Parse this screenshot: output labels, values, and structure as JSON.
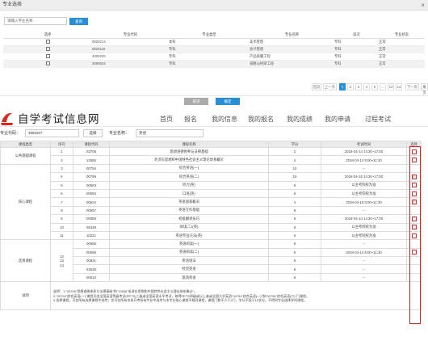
{
  "dialog": {
    "title": "专业选择",
    "close_icon": "close-icon",
    "search_placeholder": "请输入专业名称",
    "search_button": "查询",
    "cancel": "取消",
    "confirm": "确定"
  },
  "major_table": {
    "headers": [
      "选择",
      "专业代码",
      "专业类型",
      "专业名称",
      "层次",
      "专业状态"
    ],
    "rows": [
      {
        "code": "0020214",
        "type": "本科",
        "name": "美术管理",
        "level": "专科",
        "status": "正常"
      },
      {
        "code": "0020116",
        "type": "专科",
        "name": "会计管理",
        "level": "专科",
        "status": "正常"
      },
      {
        "code": "4302220",
        "type": "专科",
        "name": "产品质量工程",
        "level": "专科",
        "status": "正常"
      },
      {
        "code": "3090602",
        "type": "专科",
        "name": "道路与桥梁工程",
        "level": "专科",
        "status": "正常"
      }
    ]
  },
  "pager": {
    "first": "首页",
    "prev": "上一页",
    "pages": [
      "1",
      "2",
      "3",
      "4",
      "5",
      "...",
      "13",
      "14"
    ],
    "next": "下一页",
    "last": "尾页"
  },
  "site": {
    "logo_text": "自学考试信息网",
    "nav": [
      "首页",
      "报名",
      "我的信息",
      "我的报名",
      "我的成绩",
      "我的申请",
      "过程考试"
    ]
  },
  "filter": {
    "code_label": "专业代码：",
    "code_value": "3050207",
    "select_button": "选择",
    "name_label": "专业名称：",
    "name_value": "英语"
  },
  "course_table": {
    "headers": [
      "课程类型",
      "序号",
      "课程代码",
      "课程名称",
      "学分",
      "考试时间",
      "选择"
    ],
    "groups": {
      "public": "公共基础课程",
      "core": "核心课程",
      "elective": "选择课程",
      "note": "说明"
    },
    "rows": [
      {
        "no": "1",
        "code": "03706",
        "name": "思想道德修养与法律基础",
        "credit": "2",
        "time": "2018-04-14 14:30~17:00"
      },
      {
        "no": "2",
        "code": "12656",
        "name": "毛泽东思想和中国特色社会主义理论体系概论",
        "credit": "4",
        "time": "2018-04-14 9:00~11:30"
      },
      {
        "no": "3",
        "code": "00794",
        "name": "综合英语(一)",
        "credit": "10",
        "time": "--"
      },
      {
        "no": "4",
        "code": "00795",
        "name": "综合英语(二)",
        "credit": "10",
        "time": "2018-04-15 14:30~17:00"
      },
      {
        "no": "5",
        "code": "00593",
        "name": "听力(英)",
        "credit": "6",
        "time": "以主考院校为准"
      },
      {
        "no": "6",
        "code": "00594",
        "name": "口语(英)",
        "credit": "6",
        "time": "以主考院校为准"
      },
      {
        "no": "7",
        "code": "00522",
        "name": "英语国家概况",
        "credit": "4",
        "time": "2018-04-15 9:00~11:30"
      },
      {
        "no": "8",
        "code": "00597",
        "name": "英语写作基础",
        "credit": "6",
        "time": "--"
      },
      {
        "no": "9",
        "code": "00089",
        "name": "初级翻译技巧",
        "credit": "6",
        "time": "2018-04-14 14:30~17:00"
      },
      {
        "no": "10",
        "code": "05348",
        "name": "阅读(二)(英)",
        "credit": "6",
        "time": "以主考院校为准"
      },
      {
        "no": "11",
        "code": "10221",
        "name": "英语专业方法(英)",
        "credit": "6",
        "time": "以主考院校为准"
      },
      {
        "no": "",
        "code": "00595",
        "name": "英语阅读(一)",
        "credit": "6",
        "time": "--"
      },
      {
        "no": "",
        "code": "00596",
        "name": "英语阅读(二)",
        "credit": "6",
        "time": "2018-04-14 9:00~11:30"
      },
      {
        "no": "",
        "code": "00831",
        "name": "英语语法",
        "credit": "6",
        "time": "--"
      },
      {
        "no": "",
        "code": "02635",
        "name": "经贸英语",
        "credit": "6",
        "time": "--"
      },
      {
        "no": "",
        "code": "00610",
        "name": "旅游英语",
        "credit": "6",
        "time": "--"
      }
    ],
    "elective_numbers": [
      "12",
      "13",
      "14"
    ],
    "note_lines": [
      "说明：1.\"03706\"思想道德修养与法律基础\"和\"12656\"毛泽东思想和中国特色社会主义理论体系概论\"。",
      "2.\"00794\"综合英语(一)\"课程可由全国英语等级考试(PETS)三级或全国英语水平考试，取得PETS四级或以上者或全国大学英语\"00794\"综合英语(一)\"和\"00795\"综合英语(二)\"门课程。",
      "3.选择课程，可在所有选择课程中选考；也可在所有本科开考所有专业中选考与本专业核心课程不相同课程，课程门数不少于3门，学分不低于10学分。不得同专业选择学科课程。"
    ]
  }
}
